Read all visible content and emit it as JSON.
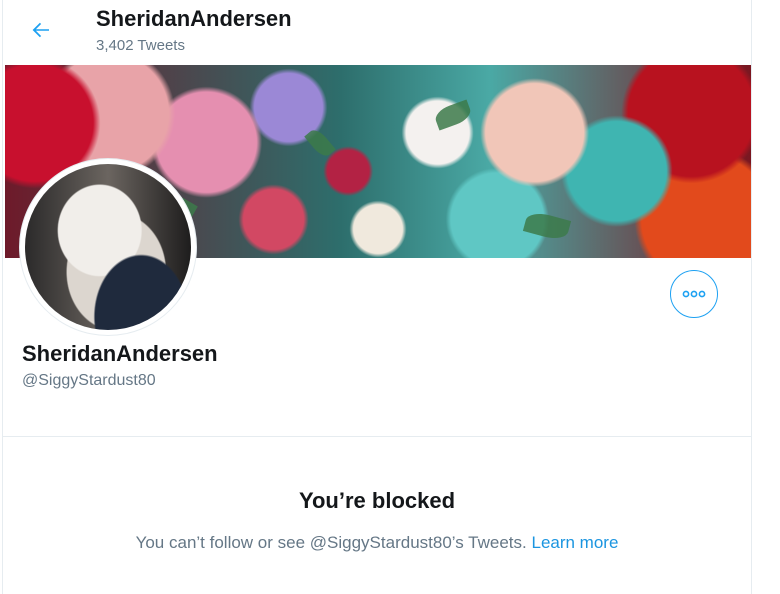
{
  "header": {
    "title": "SheridanAndersen",
    "tweet_count": "3,402 Tweets",
    "back_icon": "arrow-left-icon"
  },
  "profile": {
    "name": "SheridanAndersen",
    "handle": "@SiggyStardust80",
    "more_icon": "more-horizontal-icon"
  },
  "blocked": {
    "title": "You’re blocked",
    "message": "You can’t follow or see @SiggyStardust80’s Tweets.",
    "link_label": "Learn more"
  },
  "colors": {
    "accent": "#1da1f2",
    "secondary_text": "#657786",
    "primary_text": "#14171a"
  }
}
